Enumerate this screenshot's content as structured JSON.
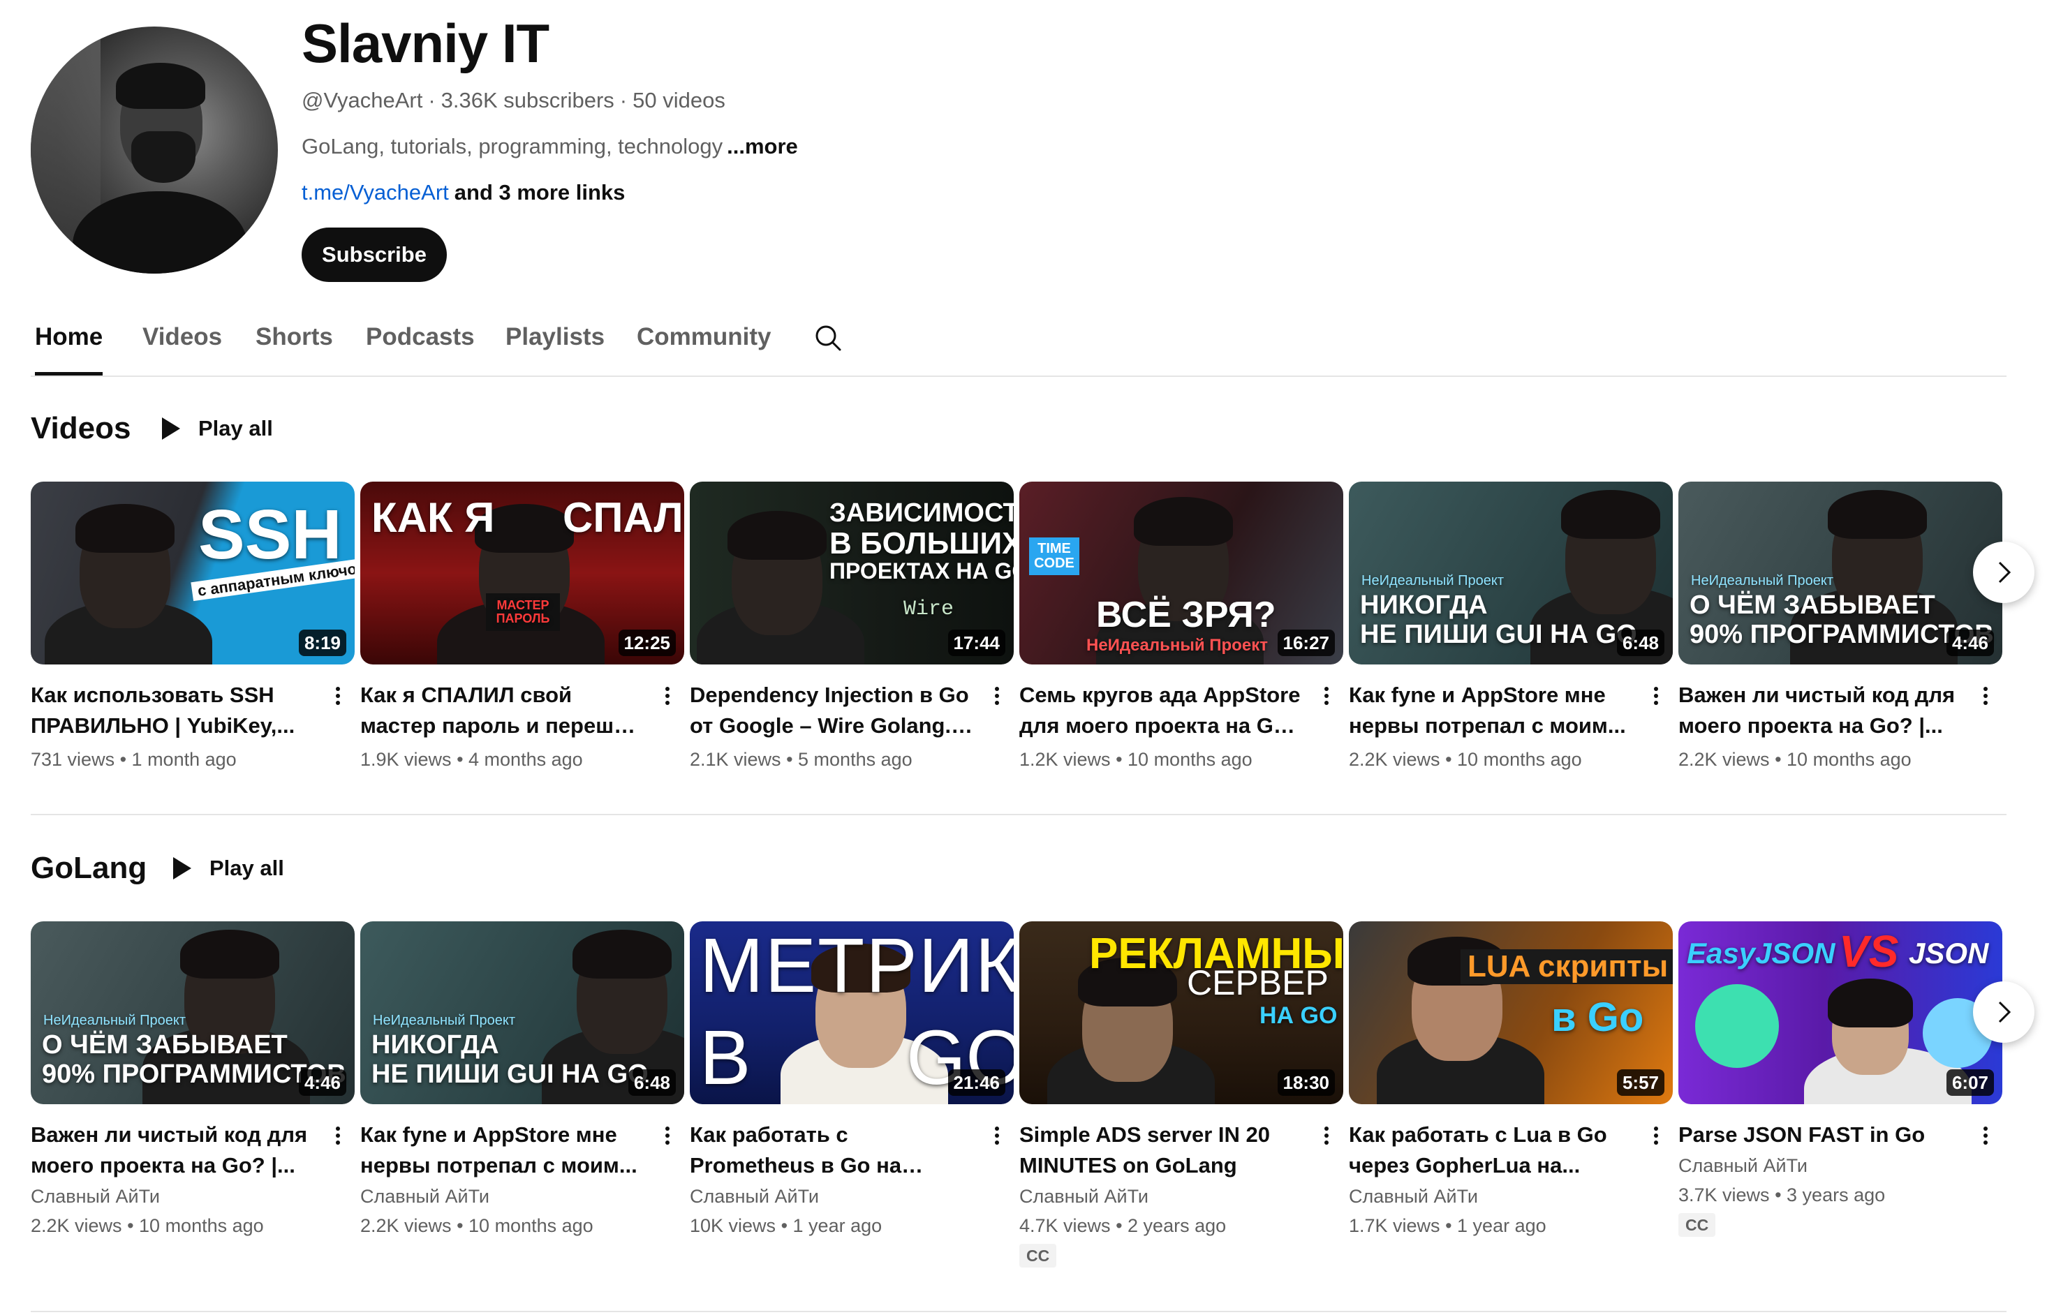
{
  "channel": {
    "name": "Slavniy IT",
    "handle": "@VyacheArt",
    "subscribers": "3.36K subscribers",
    "videos_count": "50 videos",
    "separator": "·",
    "description": "GoLang, tutorials, programming, technology",
    "more_label": "...more",
    "link": "t.me/VyacheArt",
    "more_links": "and 3 more links",
    "subscribe_label": "Subscribe"
  },
  "tabs": [
    {
      "label": "Home",
      "active": true
    },
    {
      "label": "Videos"
    },
    {
      "label": "Shorts"
    },
    {
      "label": "Podcasts"
    },
    {
      "label": "Playlists"
    },
    {
      "label": "Community"
    }
  ],
  "sections": [
    {
      "title": "Videos",
      "play_all": "Play all",
      "videos": [
        {
          "title": "Как использовать SSH ПРАВИЛЬНО | YubiKey,...",
          "views": "731 views",
          "age": "1 month ago",
          "duration": "8:19",
          "thumb_text": [
            "SSH",
            "с аппаратным ключом"
          ]
        },
        {
          "title": "Как я СПАЛИЛ свой мастер пароль и перешёл на...",
          "views": "1.9K views",
          "age": "4 months ago",
          "duration": "12:25",
          "thumb_text": [
            "КАК Я",
            "СПАЛИЛ",
            "МАСТЕР ПАРОЛЬ"
          ]
        },
        {
          "title": "Dependency Injection в Go от Google – Wire Golang. ГАЙД",
          "views": "2.1K views",
          "age": "5 months ago",
          "duration": "17:44",
          "thumb_text": [
            "ЗАВИСИМОСТИ",
            "В БОЛЬШИХ",
            "ПРОЕКТАХ НА GO",
            "Wire"
          ]
        },
        {
          "title": "Семь кругов ада AppStore для моего проекта на Go |...",
          "views": "1.2K views",
          "age": "10 months ago",
          "duration": "16:27",
          "thumb_text": [
            "TIME CODE",
            "ВСЁ ЗРЯ?",
            "НеИдеальный Проект"
          ]
        },
        {
          "title": "Как fyne и AppStore мне нервы потрепал с моим...",
          "views": "2.2K views",
          "age": "10 months ago",
          "duration": "6:48",
          "thumb_text": [
            "НеИдеальный Проект",
            "НИКОГДА",
            "НЕ ПИШИ GUI НА GO"
          ]
        },
        {
          "title": "Важен ли чистый код для моего проекта на Go? |...",
          "views": "2.2K views",
          "age": "10 months ago",
          "duration": "4:46",
          "thumb_text": [
            "НеИдеальный Проект",
            "О ЧЁМ ЗАБЫВАЕТ",
            "90% ПРОГРАММИСТОВ"
          ]
        }
      ]
    },
    {
      "title": "GoLang",
      "play_all": "Play all",
      "videos": [
        {
          "title": "Важен ли чистый код для моего проекта на Go? |...",
          "channel": "Славный АйТи",
          "views": "2.2K views",
          "age": "10 months ago",
          "duration": "4:46",
          "thumb_text": [
            "НеИдеальный Проект",
            "О ЧЁМ ЗАБЫВАЕТ",
            "90% ПРОГРАММИСТОВ"
          ]
        },
        {
          "title": "Как fyne и AppStore мне нервы потрепал с моим...",
          "channel": "Славный АйТи",
          "views": "2.2K views",
          "age": "10 months ago",
          "duration": "6:48",
          "thumb_text": [
            "НеИдеальный Проект",
            "НИКОГДА",
            "НЕ ПИШИ GUI НА GO"
          ]
        },
        {
          "title": "Как работать с Prometheus в Go на примере...",
          "channel": "Славный АйТи",
          "views": "10K views",
          "age": "1 year ago",
          "duration": "21:46",
          "thumb_text": [
            "МЕТРИКИ",
            "В",
            "GO"
          ]
        },
        {
          "title": "Simple ADS server IN 20 MINUTES on GoLang",
          "channel": "Славный АйТи",
          "views": "4.7K views",
          "age": "2 years ago",
          "duration": "18:30",
          "cc": "CC",
          "thumb_text": [
            "РЕКЛАМНЫЙ",
            "СЕРВЕР",
            "НА GO"
          ]
        },
        {
          "title": "Как работать с Lua в Go через GopherLua на...",
          "channel": "Славный АйТи",
          "views": "1.7K views",
          "age": "1 year ago",
          "duration": "5:57",
          "thumb_text": [
            "LUA скрипты",
            "в Go"
          ]
        },
        {
          "title": "Parse JSON FAST in Go",
          "channel": "Славный АйТи",
          "views": "3.7K views",
          "age": "3 years ago",
          "duration": "6:07",
          "cc": "CC",
          "thumb_text": [
            "EasyJSON",
            "VS",
            "JSON"
          ]
        }
      ]
    }
  ],
  "colors": {
    "text": "#0f0f0f",
    "secondary": "#606060",
    "link": "#065fd4",
    "divider": "#e5e5e5"
  },
  "icons": [
    "search-icon",
    "play-icon",
    "chevron-right-icon",
    "more-vert-icon"
  ]
}
